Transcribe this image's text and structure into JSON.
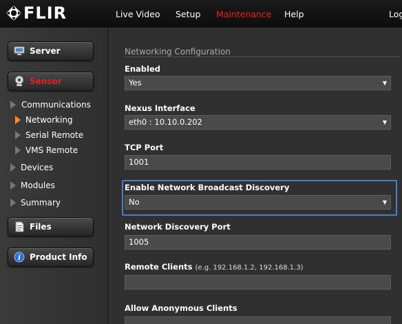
{
  "brand": {
    "logo_text": "FLIR"
  },
  "nav": {
    "items": [
      {
        "label": "Live Video"
      },
      {
        "label": "Setup"
      },
      {
        "label": "Maintenance"
      },
      {
        "label": "Help"
      },
      {
        "label": "Log"
      }
    ],
    "active_color": "#e02020"
  },
  "sidebar": {
    "server": "Server",
    "sensor": "Sensor",
    "sensor_items": [
      {
        "label": "Communications"
      },
      {
        "label": "Networking"
      },
      {
        "label": "Serial Remote"
      },
      {
        "label": "VMS Remote"
      }
    ],
    "items": [
      {
        "label": "Devices"
      },
      {
        "label": "Modules"
      },
      {
        "label": "Summary"
      }
    ],
    "files": "Files",
    "product_info": "Product Info"
  },
  "main": {
    "section_title": "Networking Configuration",
    "fields": {
      "enabled": {
        "label": "Enabled",
        "value": "Yes"
      },
      "nexus_interface": {
        "label": "Nexus Interface",
        "value": "eth0 : 10.10.0.202"
      },
      "tcp_port": {
        "label": "TCP Port",
        "value": "1001"
      },
      "broadcast_discovery": {
        "label": "Enable Network Broadcast Discovery",
        "value": "No"
      },
      "discovery_port": {
        "label": "Network Discovery Port",
        "value": "1005"
      },
      "remote_clients": {
        "label": "Remote Clients",
        "hint": "(e.g. 192.168.1.2, 192.168.1.3)",
        "value": ""
      },
      "anonymous_clients": {
        "label": "Allow Anonymous Clients",
        "value": ""
      }
    },
    "arrow_glyph": "▼"
  }
}
